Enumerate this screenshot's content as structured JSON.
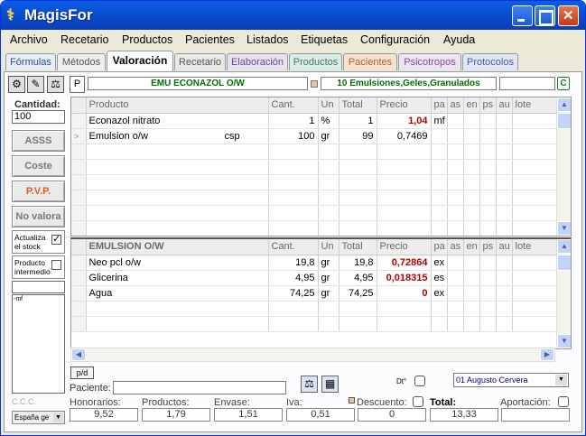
{
  "window": {
    "title": "MagisFor"
  },
  "menu": [
    "Archivo",
    "Recetario",
    "Productos",
    "Pacientes",
    "Listados",
    "Etiquetas",
    "Configuración",
    "Ayuda"
  ],
  "tabs": [
    {
      "label": "Fórmulas",
      "color": "#e8edf5",
      "text": "#2b4f8a"
    },
    {
      "label": "Métodos",
      "color": "#eeeeee",
      "text": "#555555"
    },
    {
      "label": "Valoración",
      "color": "#fcfcfe",
      "text": "#000000"
    },
    {
      "label": "Recetario",
      "color": "#e8e8e8",
      "text": "#555555"
    },
    {
      "label": "Elaboración",
      "color": "#e7e2f0",
      "text": "#6b4d8c"
    },
    {
      "label": "Productos",
      "color": "#dcece6",
      "text": "#3d7a62"
    },
    {
      "label": "Pacientes",
      "color": "#f7e2d2",
      "text": "#b45e2c"
    },
    {
      "label": "Psicotropos",
      "color": "#ece4f0",
      "text": "#8a4d92"
    },
    {
      "label": "Protocolos",
      "color": "#e2e6f5",
      "text": "#4a5a9e"
    }
  ],
  "toolbar": {
    "p_label": "P",
    "formula_name": "EMU ECONAZOL O/W",
    "category": "10 Emulsiones,Geles,Granulados",
    "c_label": "C"
  },
  "left": {
    "qty_label": "Cantidad:",
    "qty_value": "100",
    "asss": "ASSS",
    "coste": "Coste",
    "pvp": "P.V.P.",
    "no_valora": "No valora",
    "actualiza": "Actualiza el stock",
    "actualiza_checked": "✓",
    "producto_intermedio": "Producto intermedio",
    "notes": "-mf",
    "ccc": "C.C.C.",
    "lang": "España ge"
  },
  "grid1": {
    "headers": [
      "Producto",
      "Cant.",
      "Un",
      "Total",
      "Precio",
      "pa",
      "as",
      "en",
      "ps",
      "au",
      "lote"
    ],
    "rows": [
      {
        "ind": "",
        "producto": "Econazol nitrato",
        "extra": "",
        "cant": "1",
        "un": "%",
        "total": "1",
        "precio": "1,04",
        "pa": "mf"
      },
      {
        "ind": ">",
        "producto": "Emulsion o/w",
        "extra": "csp",
        "cant": "100",
        "un": "gr",
        "total": "99",
        "precio": "0,7469",
        "pa": ""
      }
    ]
  },
  "grid2": {
    "headers": [
      "EMULSION O/W",
      "Cant.",
      "Un",
      "Total",
      "Precio",
      "pa",
      "as",
      "en",
      "ps",
      "au",
      "lote"
    ],
    "rows": [
      {
        "producto": "Neo pcl o/w",
        "cant": "19,8",
        "un": "gr",
        "total": "19,8",
        "precio": "0,72864",
        "pa": "ex"
      },
      {
        "producto": "Glicerina",
        "cant": "4,95",
        "un": "gr",
        "total": "4,95",
        "precio": "0,018315",
        "pa": "es"
      },
      {
        "producto": "Agua",
        "cant": "74,25",
        "un": "gr",
        "total": "74,25",
        "precio": "0",
        "pa": "ex"
      }
    ]
  },
  "bottom": {
    "pd": "p/d",
    "paciente": "Paciente:",
    "dt": "Dt°",
    "doctor": "01 Augusto Cervera",
    "honorarios_l": "Honorarios:",
    "honorarios": "9,52",
    "productos_l": "Productos:",
    "productos": "1,79",
    "envase_l": "Envase:",
    "envase": "1,51",
    "iva_l": "Iva:",
    "iva": "0,51",
    "descuento_l": "Descuento:",
    "descuento": "0",
    "total_l": "Total:",
    "total": "13,33",
    "aportacion_l": "Aportación:",
    "aportacion": ""
  }
}
